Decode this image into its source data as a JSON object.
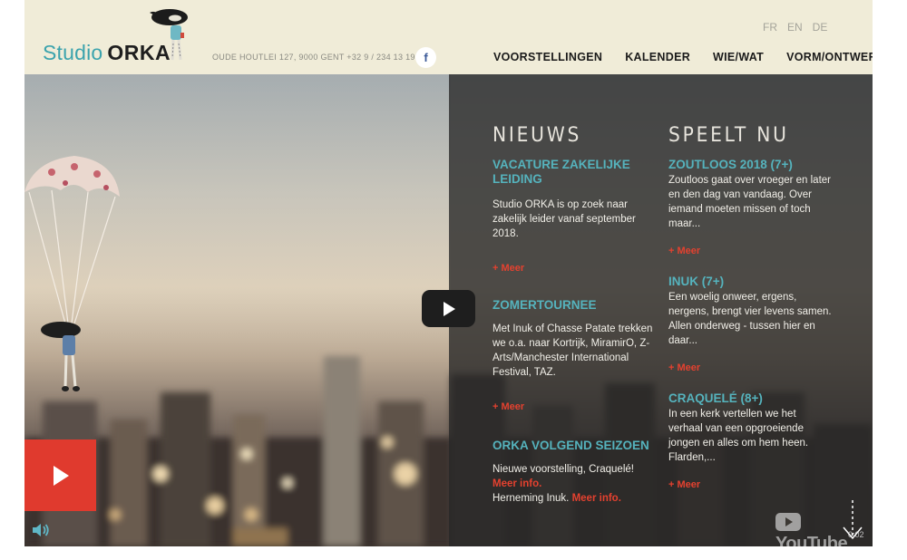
{
  "header": {
    "logo": {
      "word1": "Studio",
      "word2": "ORKA"
    },
    "address": "OUDE HOUTLEI 127, 9000 GENT +32 9 / 234 13 19",
    "facebook_icon": "facebook-icon",
    "languages": [
      "FR",
      "EN",
      "DE"
    ],
    "nav": [
      "VOORSTELLINGEN",
      "KALENDER",
      "WIE/WAT",
      "VORM/ONTWERP"
    ]
  },
  "news": {
    "heading": "NIEUWS",
    "items": [
      {
        "title": "VACATURE ZAKELIJKE LEIDING",
        "body": "Studio ORKA is op zoek naar zakelijk leider vanaf september 2018.",
        "more": "+ Meer"
      },
      {
        "title": "ZOMERTOURNEE",
        "body": "Met Inuk of Chasse Patate trekken we o.a. naar Kortrijk, MiramirO, Z-Arts/Manchester International Festival, TAZ.",
        "more": "+ Meer"
      },
      {
        "title": "ORKA VOLGEND SEIZOEN",
        "line1": "Nieuwe voorstelling, Craquelé!",
        "link1": "Meer info.",
        "line2": "Herneming Inuk.",
        "link2": "Meer info."
      }
    ]
  },
  "playing": {
    "heading": "SPEELT NU",
    "items": [
      {
        "title": "ZOUTLOOS 2018 (7+)",
        "body": "Zoutloos gaat over vroeger en later en den dag van vandaag. Over iemand moeten missen of toch maar...",
        "more": "+ Meer"
      },
      {
        "title": "INUK (7+)",
        "body": "Een woelig onweer, ergens, nergens, brengt vier levens samen. Allen onderweg - tussen hier en daar...",
        "more": "+ Meer"
      },
      {
        "title": "CRAQUELÉ (8+)",
        "body": "In een kerk vertellen we het verhaal van een opgroeiende jongen en alles om hem heen. Flarden,...",
        "more": "+ Meer"
      }
    ]
  },
  "video": {
    "youtube_label": "YouTube",
    "timecode": "0:02",
    "accent_red": "#e03a2e",
    "accent_teal": "#55b3bd"
  }
}
